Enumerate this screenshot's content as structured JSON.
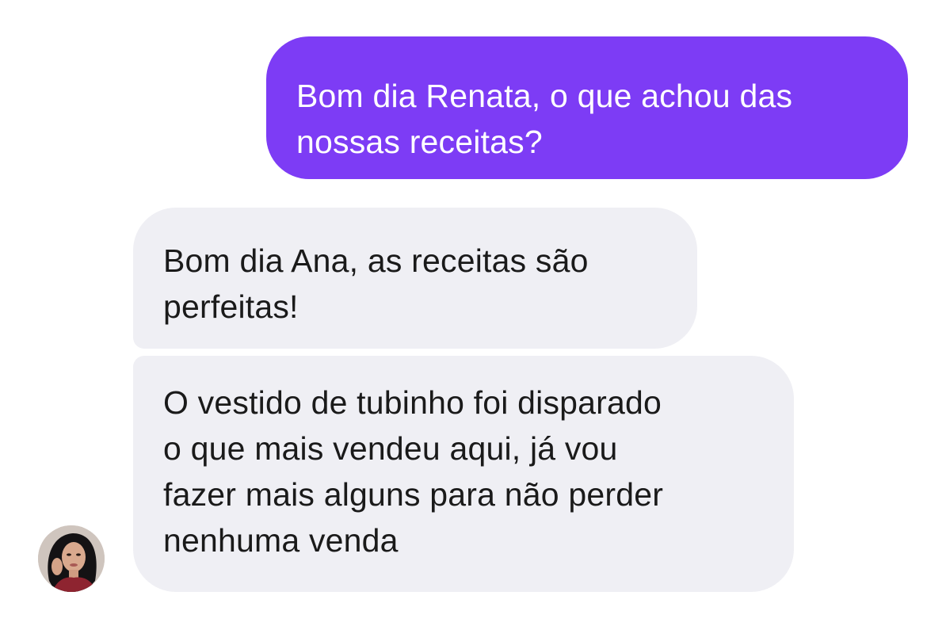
{
  "conversation": {
    "messages": [
      {
        "direction": "sent",
        "text": "Bom dia Renata, o que achou das\nnossas receitas?"
      },
      {
        "direction": "received",
        "text": "Bom dia Ana, as receitas são\nperfeitas!"
      },
      {
        "direction": "received",
        "text": "O vestido de tubinho foi disparado\no que mais vendeu aqui, já vou\nfazer mais alguns para não perder\nnenhuma venda"
      }
    ],
    "colors": {
      "sent_bubble": "#7d3cf5",
      "received_bubble": "#efeff4",
      "sent_text": "#ffffff",
      "received_text": "#1a1a1a"
    }
  }
}
